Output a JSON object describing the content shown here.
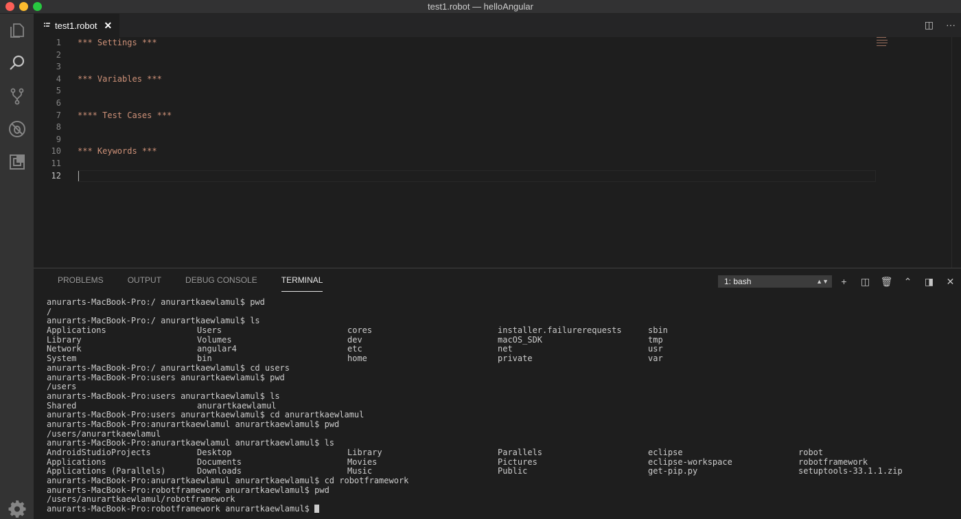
{
  "window": {
    "title": "test1.robot — helloAngular"
  },
  "activity_bar": {
    "items": [
      {
        "name": "explorer-icon"
      },
      {
        "name": "search-icon"
      },
      {
        "name": "source-control-icon"
      },
      {
        "name": "debug-icon"
      },
      {
        "name": "extensions-icon"
      }
    ],
    "settings": {
      "name": "gear-icon"
    }
  },
  "editor_tabs": [
    {
      "label": "test1.robot",
      "close": "✕"
    }
  ],
  "editor_actions": {
    "split": "◫",
    "more": "···"
  },
  "editor": {
    "active_line": 12,
    "lines": [
      {
        "n": "1",
        "text": "*** Settings ***"
      },
      {
        "n": "2",
        "text": ""
      },
      {
        "n": "3",
        "text": ""
      },
      {
        "n": "4",
        "text": "*** Variables ***"
      },
      {
        "n": "5",
        "text": ""
      },
      {
        "n": "6",
        "text": ""
      },
      {
        "n": "7",
        "text": "**** Test Cases ***"
      },
      {
        "n": "8",
        "text": ""
      },
      {
        "n": "9",
        "text": ""
      },
      {
        "n": "10",
        "text": "*** Keywords ***"
      },
      {
        "n": "11",
        "text": ""
      },
      {
        "n": "12",
        "text": ""
      }
    ]
  },
  "panel": {
    "tabs": [
      "PROBLEMS",
      "OUTPUT",
      "DEBUG CONSOLE",
      "TERMINAL"
    ],
    "active_tab": "TERMINAL",
    "terminal_select": "1: bash",
    "actions": [
      "+",
      "◫",
      "🗑",
      "⌃",
      "◨",
      "✕"
    ]
  },
  "terminal": {
    "lines": [
      [
        "anurarts-MacBook-Pro:/ anurartkaewlamul$ pwd"
      ],
      [
        "/"
      ],
      [
        "anurarts-MacBook-Pro:/ anurartkaewlamul$ ls"
      ],
      [
        "Applications",
        "Users",
        "cores",
        "installer.failurerequests",
        "sbin"
      ],
      [
        "Library",
        "Volumes",
        "dev",
        "macOS_SDK",
        "tmp"
      ],
      [
        "Network",
        "angular4",
        "etc",
        "net",
        "usr"
      ],
      [
        "System",
        "bin",
        "home",
        "private",
        "var"
      ],
      [
        "anurarts-MacBook-Pro:/ anurartkaewlamul$ cd users"
      ],
      [
        "anurarts-MacBook-Pro:users anurartkaewlamul$ pwd"
      ],
      [
        "/users"
      ],
      [
        "anurarts-MacBook-Pro:users anurartkaewlamul$ ls"
      ],
      [
        "Shared",
        "anurartkaewlamul"
      ],
      [
        "anurarts-MacBook-Pro:users anurartkaewlamul$ cd anurartkaewlamul"
      ],
      [
        "anurarts-MacBook-Pro:anurartkaewlamul anurartkaewlamul$ pwd"
      ],
      [
        "/users/anurartkaewlamul"
      ],
      [
        "anurarts-MacBook-Pro:anurartkaewlamul anurartkaewlamul$ ls"
      ],
      [
        "AndroidStudioProjects",
        "Desktop",
        "Library",
        "Parallels",
        "eclipse",
        "robot"
      ],
      [
        "Applications",
        "Documents",
        "Movies",
        "Pictures",
        "eclipse-workspace",
        "robotframework"
      ],
      [
        "Applications (Parallels)",
        "Downloads",
        "Music",
        "Public",
        "get-pip.py",
        "setuptools-33.1.1.zip"
      ],
      [
        "anurarts-MacBook-Pro:anurartkaewlamul anurartkaewlamul$ cd robotframework"
      ],
      [
        "anurarts-MacBook-Pro:robotframework anurartkaewlamul$ pwd"
      ],
      [
        "/users/anurartkaewlamul/robotframework"
      ],
      [
        "anurarts-MacBook-Pro:robotframework anurartkaewlamul$ "
      ]
    ]
  }
}
